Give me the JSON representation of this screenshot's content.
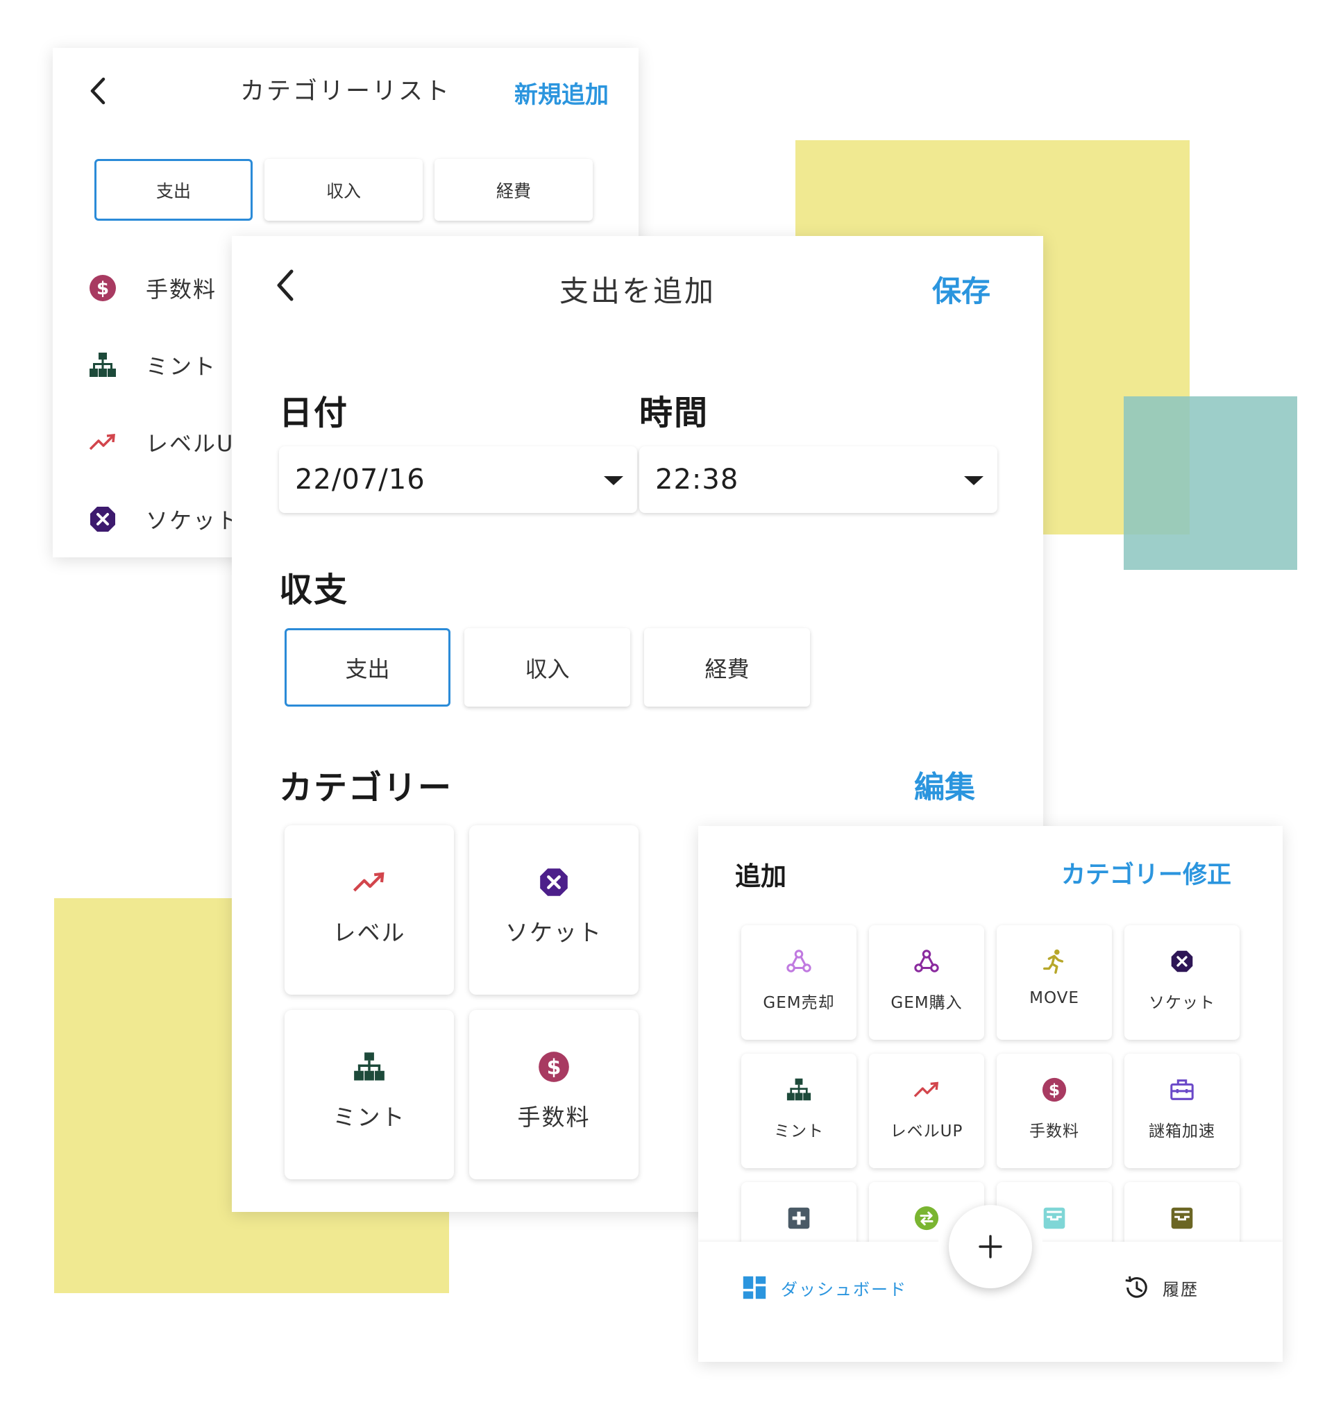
{
  "category_list_panel": {
    "title": "カテゴリーリスト",
    "action": "新規追加",
    "tabs": [
      "支出",
      "収入",
      "経費"
    ],
    "items": [
      {
        "label": "手数料",
        "icon": "dollar-coin-icon"
      },
      {
        "label": "ミント",
        "icon": "hierarchy-icon"
      },
      {
        "label": "レベルUP",
        "icon": "trending-up-icon"
      },
      {
        "label": "ソケット",
        "icon": "x-octagon-icon"
      }
    ]
  },
  "add_expense_panel": {
    "title": "支出を追加",
    "save": "保存",
    "date_label": "日付",
    "time_label": "時間",
    "date_value": "22/07/16",
    "time_value": "22:38",
    "type_label": "収支",
    "types": [
      "支出",
      "収入",
      "経費"
    ],
    "category_label": "カテゴリー",
    "edit": "編集",
    "categories": [
      {
        "label": "レベル",
        "icon": "trending-up-icon"
      },
      {
        "label": "ソケット",
        "icon": "x-octagon-icon"
      },
      {
        "label": "ミント",
        "icon": "hierarchy-icon"
      },
      {
        "label": "手数料",
        "icon": "dollar-coin-icon"
      }
    ]
  },
  "quick_add_panel": {
    "title": "追加",
    "action": "カテゴリー修正",
    "tiles": [
      {
        "label": "GEM売却",
        "icon": "webhook-icon"
      },
      {
        "label": "GEM購入",
        "icon": "webhook-icon"
      },
      {
        "label": "MOVE",
        "icon": "runner-icon"
      },
      {
        "label": "ソケット",
        "icon": "x-octagon-icon"
      },
      {
        "label": "ミント",
        "icon": "hierarchy-icon"
      },
      {
        "label": "レベルUP",
        "icon": "trending-up-icon"
      },
      {
        "label": "手数料",
        "icon": "dollar-coin-icon"
      },
      {
        "label": "謎箱加速",
        "icon": "toolbox-icon"
      },
      {
        "label": "",
        "icon": "medical-plus-icon"
      },
      {
        "label": "",
        "icon": "swap-circle-icon"
      },
      {
        "label": "",
        "icon": "inbox-tray-icon"
      },
      {
        "label": "",
        "icon": "inbox-tray-icon"
      }
    ],
    "fab_symbol": "+",
    "nav": {
      "dashboard": "ダッシュボード",
      "history": "履歴"
    }
  },
  "colors": {
    "accent": "#2b95de",
    "deco_yellow": "#f0e991",
    "deco_teal": "#8cc6c0",
    "fee_icon": "#a83a61",
    "mint_icon": "#1d4a3a",
    "levelup_icon": "#d2454c",
    "socket_icon": "#3d1a6e"
  }
}
